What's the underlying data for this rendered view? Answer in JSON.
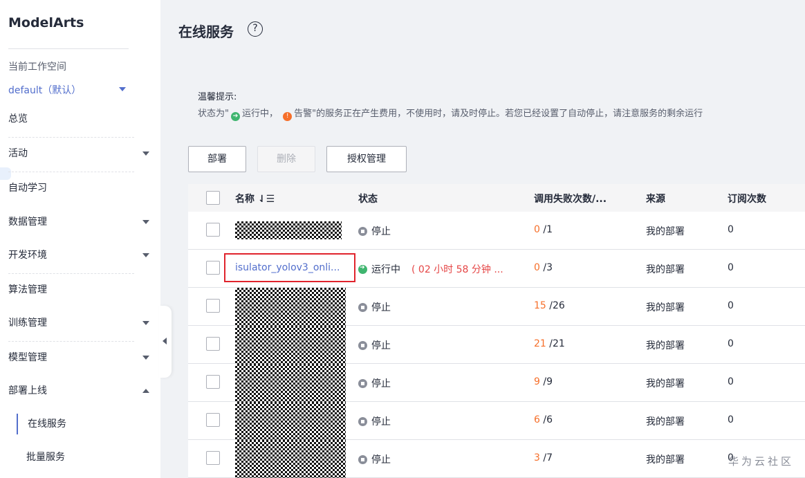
{
  "app": {
    "title": "ModelArts"
  },
  "sidebar": {
    "workspace_label": "当前工作空间",
    "workspace_value": "default（默认）",
    "items": [
      {
        "label": "总览"
      },
      {
        "label": "活动"
      },
      {
        "label": "自动学习"
      },
      {
        "label": "数据管理"
      },
      {
        "label": "开发环境"
      },
      {
        "label": "算法管理"
      },
      {
        "label": "训练管理"
      },
      {
        "label": "模型管理"
      },
      {
        "label": "部署上线"
      }
    ],
    "sub_items": [
      {
        "label": "在线服务"
      },
      {
        "label": "批量服务"
      }
    ]
  },
  "page": {
    "title": "在线服务",
    "help": "?"
  },
  "tip": {
    "title": "温馨提示:",
    "prefix": "状态为\"",
    "running": "运行中，",
    "warning": "告警",
    "suffix": "\"的服务正在产生费用，不使用时，请及时停止。若您已经设置了自动停止，请注意服务的剩余运行"
  },
  "toolbar": {
    "deploy": "部署",
    "delete": "删除",
    "auth": "授权管理"
  },
  "table": {
    "headers": {
      "name": "名称 ⇃☰",
      "status": "状态",
      "calls": "调用失败次数/...",
      "source": "来源",
      "subs": "订阅次数"
    },
    "rows": [
      {
        "name": "",
        "status": "停止",
        "fail": "0",
        "total": " /1",
        "source": "我的部署",
        "subs": "0"
      },
      {
        "name": "isulator_yolov3_onli...",
        "status": "运行中",
        "time": "( 02 小时 58 分钟 ...",
        "fail": "0",
        "total": " /3",
        "source": "我的部署",
        "subs": "0"
      },
      {
        "name": "",
        "status": "停止",
        "fail": "15",
        "total": " /26",
        "source": "我的部署",
        "subs": "0"
      },
      {
        "name": "",
        "status": "停止",
        "fail": "21",
        "total": " /21",
        "source": "我的部署",
        "subs": "0"
      },
      {
        "name": "",
        "status": "停止",
        "fail": "9",
        "total": " /9",
        "source": "我的部署",
        "subs": "0"
      },
      {
        "name": "",
        "status": "停止",
        "fail": "6",
        "total": " /6",
        "source": "我的部署",
        "subs": "0"
      },
      {
        "name": "",
        "status": "停止",
        "fail": "3",
        "total": " /7",
        "source": "我的部署",
        "subs": "0"
      }
    ]
  },
  "watermark": "华为云社区",
  "colors": {
    "accent": "#526ecc",
    "running": "#3fb56f",
    "warning": "#f66f2a",
    "highlight": "#e0232c"
  }
}
